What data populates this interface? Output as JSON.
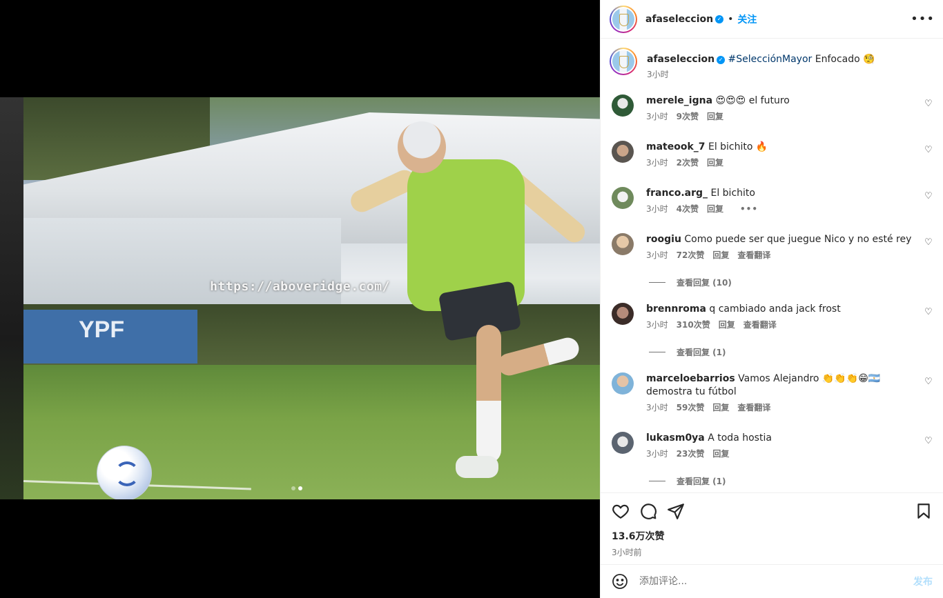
{
  "post": {
    "username": "afaseleccion",
    "follow_label": "关注",
    "caption_hashtag": "#SelecciónMayor",
    "caption_text": "Enfocado 🧐",
    "caption_time": "3小时",
    "image_watermark": "https://aboveridge.com/",
    "carousel": {
      "count": 2,
      "active": 2
    }
  },
  "comments": [
    {
      "user": "merele_igna",
      "text": "😍😍😍 el futuro",
      "time": "3小时",
      "likes": "9次赞",
      "reply": "回复",
      "translate": "",
      "more": "",
      "view_replies": ""
    },
    {
      "user": "mateook_7",
      "text": "El bichito 🔥",
      "time": "3小时",
      "likes": "2次赞",
      "reply": "回复",
      "translate": "",
      "more": "",
      "view_replies": ""
    },
    {
      "user": "franco.arg_",
      "text": "El bichito",
      "time": "3小时",
      "likes": "4次赞",
      "reply": "回复",
      "translate": "",
      "more": "•••",
      "view_replies": ""
    },
    {
      "user": "roogiu",
      "text": "Como puede ser que juegue Nico y no esté rey",
      "time": "3小时",
      "likes": "72次赞",
      "reply": "回复",
      "translate": "查看翻译",
      "more": "",
      "view_replies": "查看回复 (10)"
    },
    {
      "user": "brennroma",
      "text": "q cambiado anda jack frost",
      "time": "3小时",
      "likes": "310次赞",
      "reply": "回复",
      "translate": "查看翻译",
      "more": "",
      "view_replies": "查看回复 (1)"
    },
    {
      "user": "marceloebarrios",
      "text": "Vamos Alejandro 👏👏👏😁🇦🇷 demostra tu fútbol",
      "time": "3小时",
      "likes": "59次赞",
      "reply": "回复",
      "translate": "查看翻译",
      "more": "",
      "view_replies": ""
    },
    {
      "user": "lukasm0ya",
      "text": "A toda hostia",
      "time": "3小时",
      "likes": "23次赞",
      "reply": "回复",
      "translate": "",
      "more": "",
      "view_replies": "查看回复 (1)"
    }
  ],
  "footer": {
    "likes": "13.6万次赞",
    "time": "3小时前",
    "comment_placeholder": "添加评论...",
    "post_label": "发布"
  },
  "icons": [
    "heart-icon",
    "comment-icon",
    "share-icon",
    "bookmark-icon",
    "emoji-icon",
    "more-icon",
    "verified-icon"
  ],
  "colors": {
    "accent": "#0095f6",
    "hashtag": "#00376b",
    "muted": "#737373",
    "post_disabled": "#b2dffc"
  }
}
